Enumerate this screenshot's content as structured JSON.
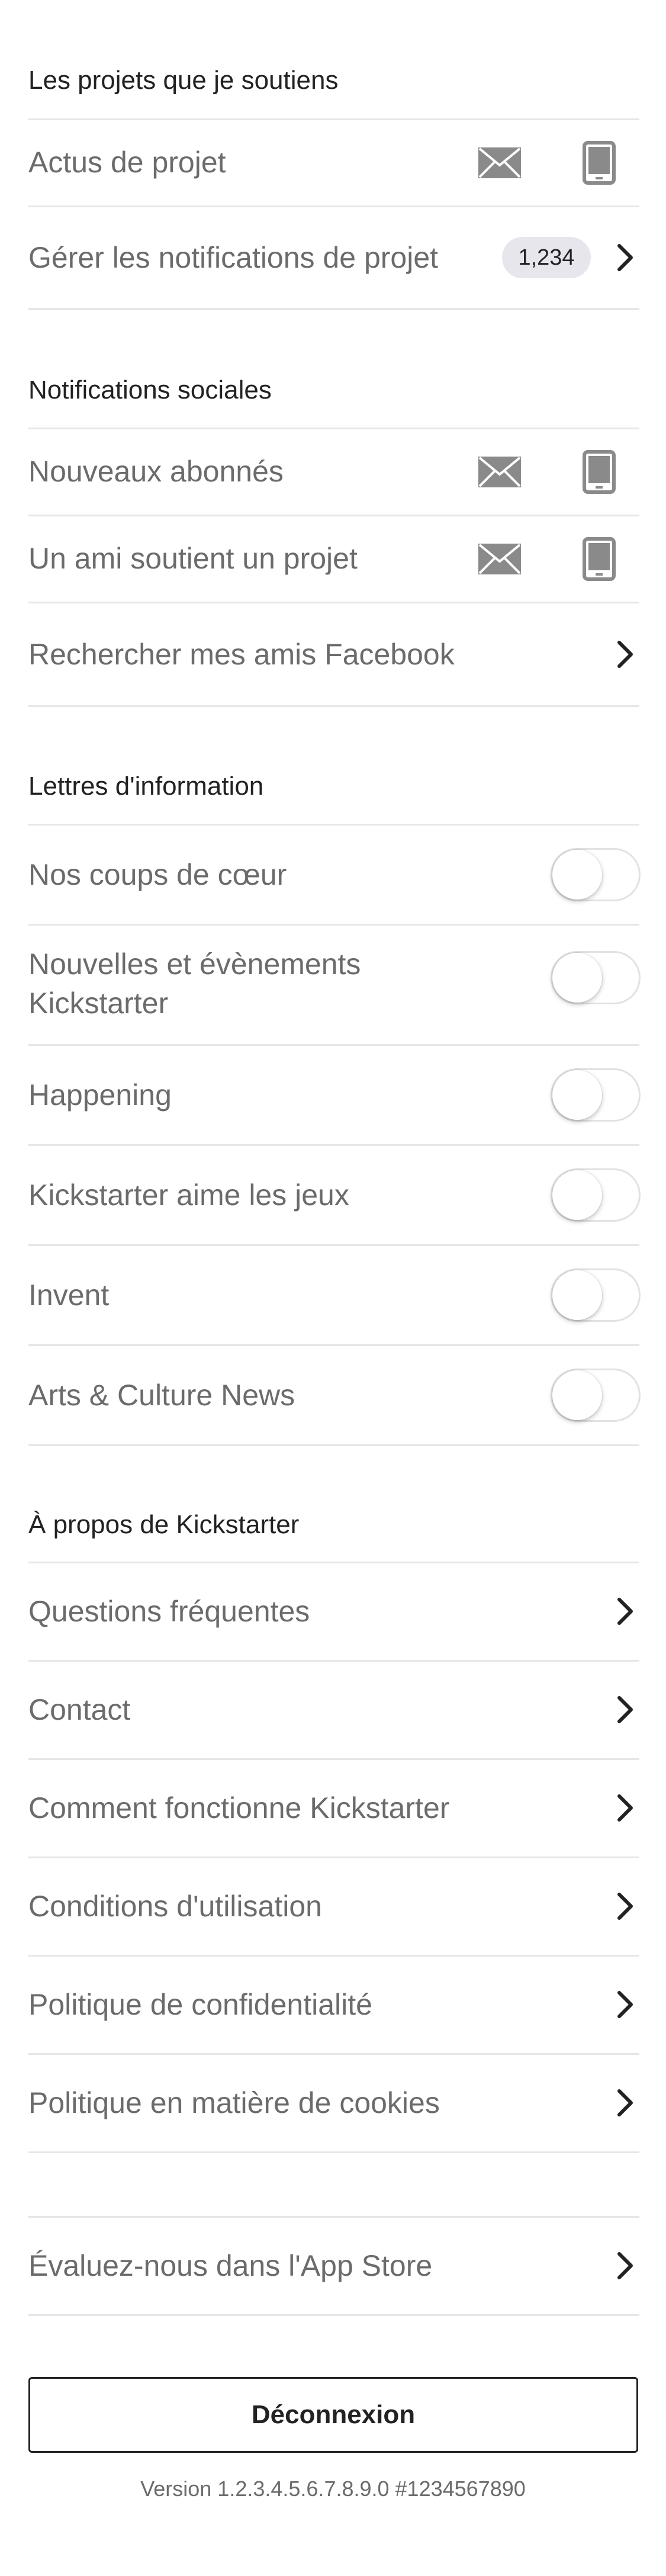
{
  "sections": {
    "backed_projects": {
      "title": "Les projets que je soutiens",
      "rows": [
        {
          "label": "Actus de projet"
        },
        {
          "label": "Gérer les notifications de projet",
          "badge": "1,234"
        }
      ]
    },
    "social": {
      "title": "Notifications sociales",
      "rows": [
        {
          "label": "Nouveaux abonnés"
        },
        {
          "label": "Un ami soutient un projet"
        },
        {
          "label": "Rechercher mes amis Facebook"
        }
      ]
    },
    "newsletters": {
      "title": "Lettres d'information",
      "rows": [
        {
          "label": "Nos coups de cœur",
          "enabled": false
        },
        {
          "label_line1": "Nouvelles et évènements",
          "label_line2": "Kickstarter",
          "enabled": false
        },
        {
          "label": "Happening",
          "enabled": false
        },
        {
          "label": "Kickstarter aime les jeux",
          "enabled": false
        },
        {
          "label": "Invent",
          "enabled": false
        },
        {
          "label": "Arts & Culture News",
          "enabled": false
        }
      ]
    },
    "about": {
      "title": "À propos de Kickstarter",
      "rows": [
        {
          "label": "Questions fréquentes"
        },
        {
          "label": "Contact"
        },
        {
          "label": "Comment fonctionne Kickstarter"
        },
        {
          "label": "Conditions d'utilisation"
        },
        {
          "label": "Politique de confidentialité"
        },
        {
          "label": "Politique en matière de cookies"
        }
      ]
    },
    "rate": {
      "label": "Évaluez-nous dans l'App Store"
    }
  },
  "logout_label": "Déconnexion",
  "version_text": "Version 1.2.3.4.5.6.7.8.9.0 #1234567890",
  "icons": {
    "mail": "mail-icon",
    "phone": "phone-icon",
    "chevron": "chevron-right-icon"
  },
  "colors": {
    "text_primary": "#222222",
    "text_secondary": "#6b6b6b",
    "divider": "#e6e6e6",
    "icon_gray": "#8a8a8a",
    "badge_bg": "#e6e6ec"
  }
}
